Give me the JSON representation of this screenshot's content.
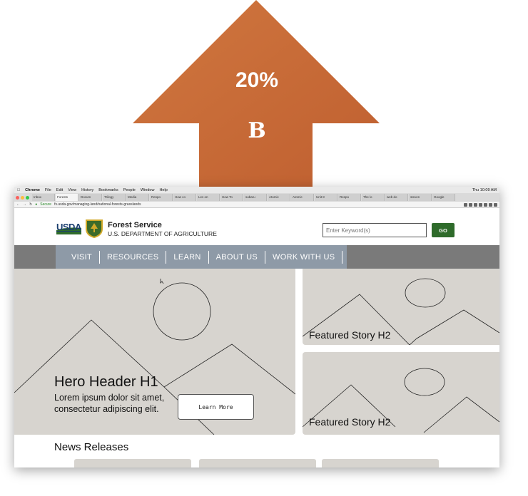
{
  "arrow": {
    "percent": "20%",
    "letter": "B",
    "color": "#c86a38"
  },
  "browser": {
    "menubar": [
      "Chrome",
      "File",
      "Edit",
      "View",
      "History",
      "Bookmarks",
      "People",
      "Window",
      "Help"
    ],
    "clock": "Thu 10:09 AM",
    "tabs": [
      "Inbox",
      "Forests",
      "Docum",
      "Trilogy",
      "Media",
      "Respo",
      "How co",
      "Les on",
      "How To",
      "subaru",
      "Atomic",
      "Atomic",
      "Unit 8",
      "Respo",
      "The lo",
      "web do",
      "steven",
      "Google"
    ],
    "address": {
      "secure_label": "Secure",
      "url": "fs.usda.gov/managing-land/national-forests-grasslands"
    }
  },
  "header": {
    "usda": "USDA",
    "org_name": "Forest Service",
    "org_sub": "U.S. DEPARTMENT OF AGRICULTURE",
    "search_placeholder": "Enter Keyword(s)",
    "go_label": "GO"
  },
  "nav": {
    "items": [
      "VISIT",
      "RESOURCES",
      "LEARN",
      "ABOUT US",
      "WORK WITH US"
    ]
  },
  "hero": {
    "title": "Hero Header H1",
    "subtitle": "Lorem ipsum dolor sit amet, consectetur adipiscing elit.",
    "button": "Learn More"
  },
  "featured": [
    {
      "title": "Featured Story H2"
    },
    {
      "title": "Featured Story H2"
    }
  ],
  "news": {
    "title": "News Releases"
  },
  "colors": {
    "nav_bg": "#7a7a7a",
    "nav_active": "#8e9aa7",
    "placeholder_bg": "#d7d4cf",
    "go_button": "#2f6b2b",
    "usda_blue": "#1b3e6f"
  }
}
